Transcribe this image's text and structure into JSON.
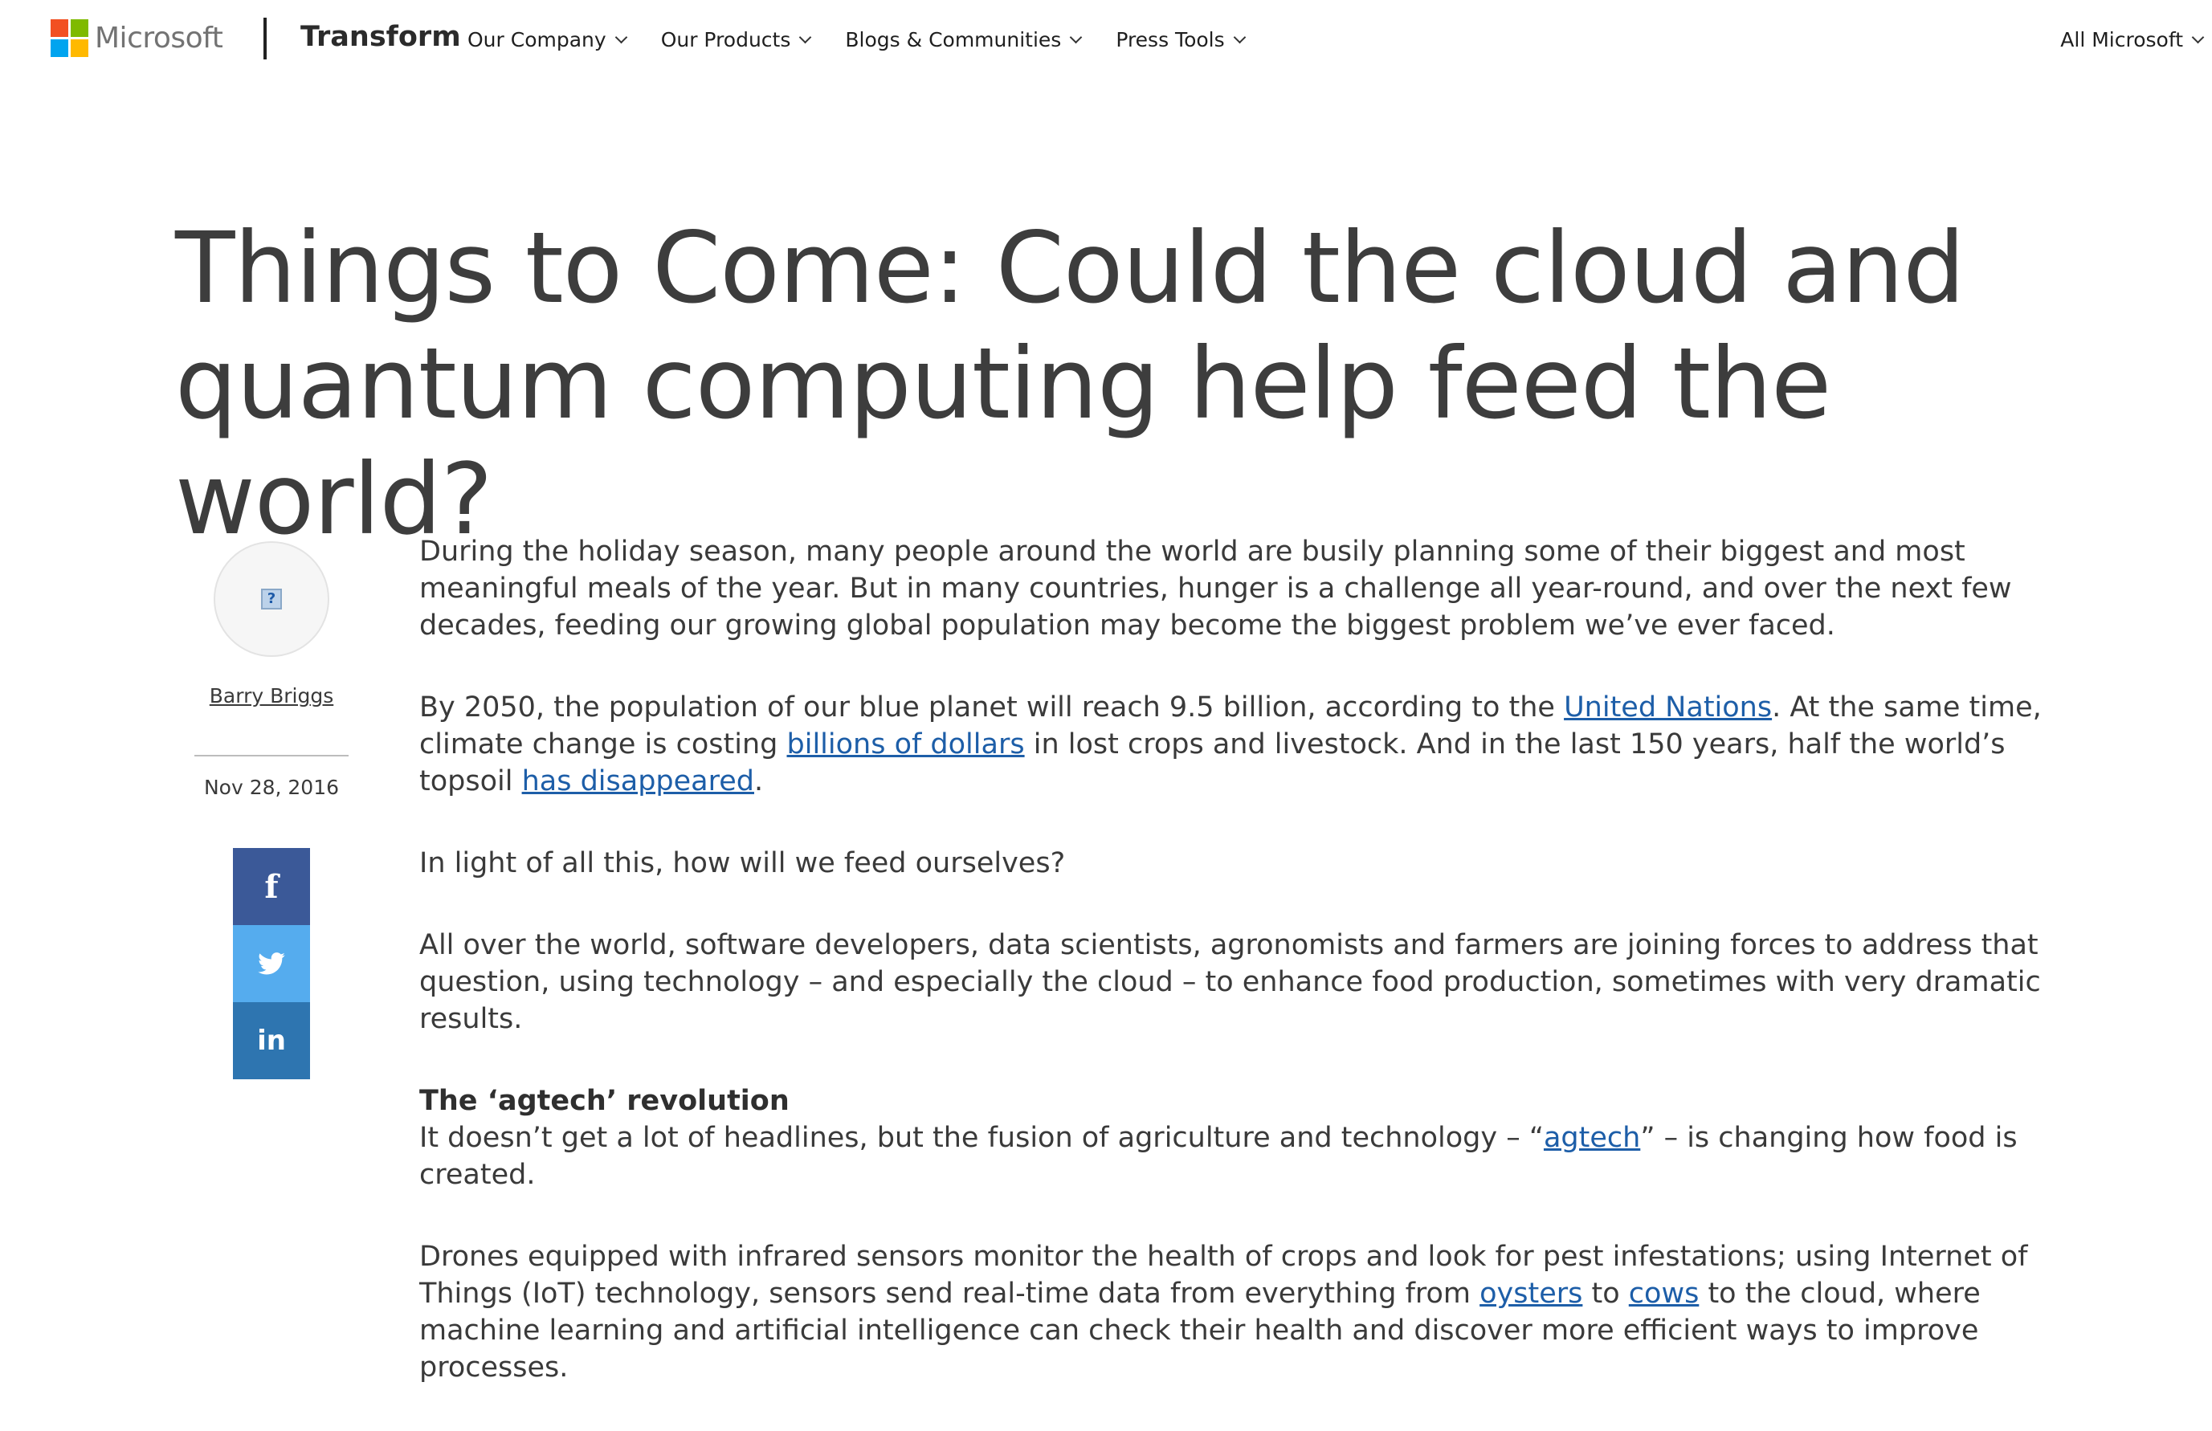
{
  "header": {
    "logo_text": "Microsoft",
    "logo_colors": [
      "#f25022",
      "#7fba00",
      "#00a4ef",
      "#ffb900"
    ],
    "brand": "Transform",
    "nav": [
      "Our Company",
      "Our Products",
      "Blogs & Communities",
      "Press Tools"
    ],
    "all_microsoft": "All Microsoft"
  },
  "article": {
    "title": "Things to Come: Could the cloud and quantum computing help feed the world?",
    "author": "Barry Briggs",
    "date": "Nov 28, 2016",
    "share": {
      "facebook_glyph": "f",
      "twitter_glyph": "🐦",
      "linkedin_glyph": "in"
    },
    "p1": "During the holiday season, many people around the world are busily planning some of their biggest and most meaningful meals of the year. But in many countries, hunger is a challenge all year-round, and over the next few decades, feeding our growing global population may become the biggest problem we’ve ever faced.",
    "p2": {
      "t1": "By 2050, the population of our blue planet will reach 9.5 billion, according to the ",
      "link1": "United Nations",
      "t2": ". At the same time, climate change is costing ",
      "link2": "billions of dollars",
      "t3": " in lost crops and livestock. And in the last 150 years, half the world’s topsoil ",
      "link3": "has disappeared",
      "t4": "."
    },
    "p3": "In light of all this, how will we feed ourselves?",
    "p4": "All over the world, software developers, data scientists, agronomists and farmers are joining forces to address that question, using technology – and especially the cloud – to enhance food production, sometimes with very dramatic results.",
    "subhead": "The ‘agtech’ revolution",
    "p5": {
      "t1": "It doesn’t get a lot of headlines, but the fusion of agriculture and technology – “",
      "link1": "agtech",
      "t2": "” – is changing how food is created."
    },
    "p6": {
      "t1": "Drones equipped with infrared sensors monitor the health of crops and look for pest infestations; using Internet of Things (IoT) technology, sensors send real-time data from everything from ",
      "link1": "oysters",
      "t2": " to ",
      "link2": "cows",
      "t3": " to the cloud, where machine learning and artificial intelligence can check their health and discover more efficient ways to improve processes."
    }
  },
  "icons": {
    "chevron": "chevron-down-icon",
    "avatar_placeholder": "broken-image-icon"
  }
}
